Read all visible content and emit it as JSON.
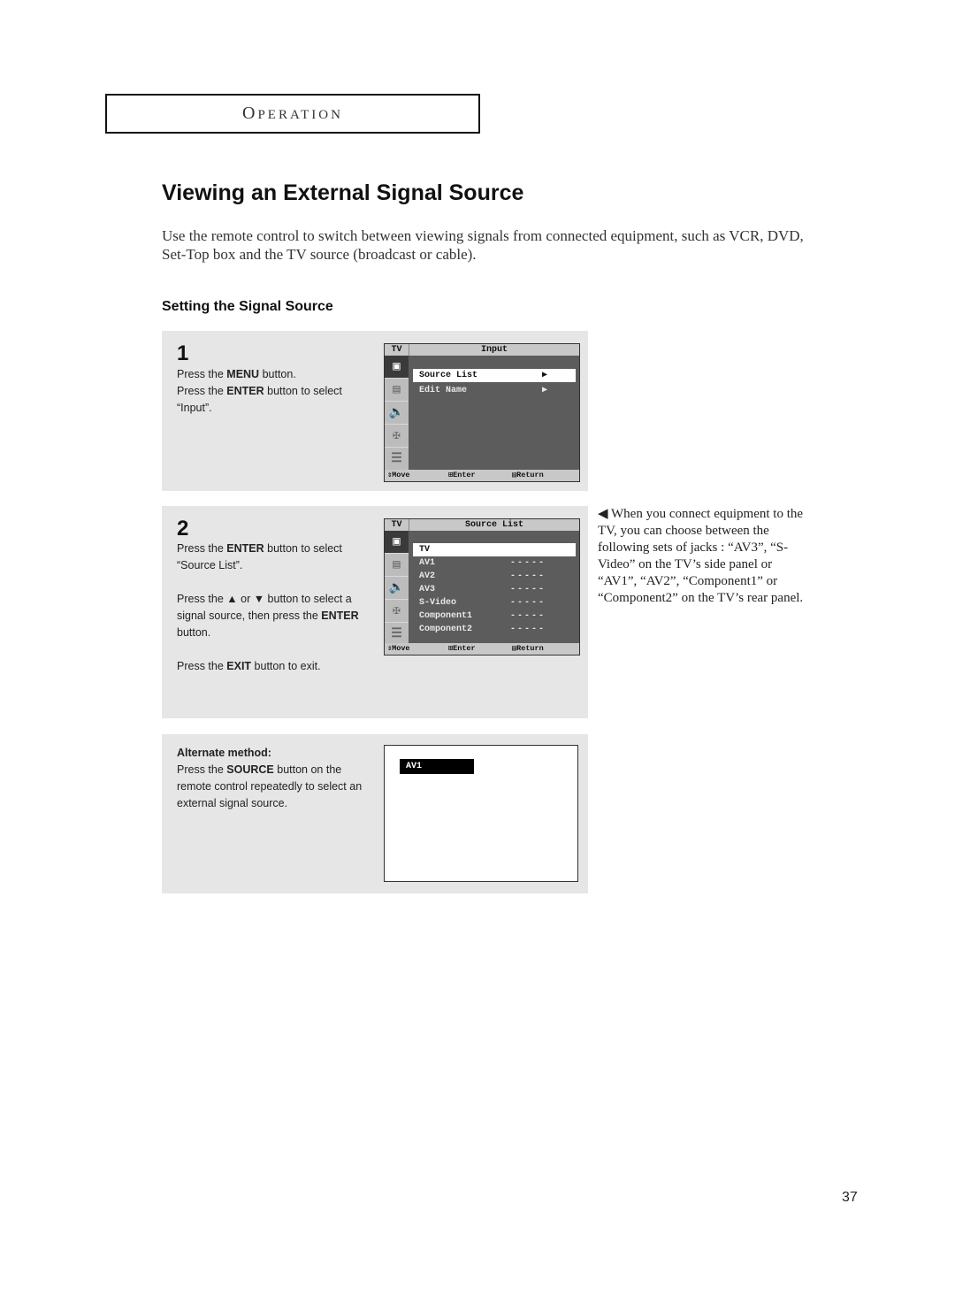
{
  "header": {
    "section_first": "O",
    "section_rest": "PERATION"
  },
  "title": "Viewing an External Signal Source",
  "intro": "Use the remote control to switch between viewing signals from connected equipment, such as VCR, DVD, Set-Top box and the TV source (broadcast or cable).",
  "subtitle": "Setting the Signal Source",
  "step1": {
    "number": "1",
    "lines": [
      {
        "pre": "Press the ",
        "bold": "MENU",
        "post": " button."
      },
      {
        "pre": "Press the ",
        "bold": "ENTER",
        "post": " button to select “Input”."
      }
    ],
    "osd": {
      "tv_label": "TV",
      "title": "Input",
      "items": [
        {
          "label": "Source List",
          "selected": true,
          "arrow": "▶"
        },
        {
          "label": "Edit Name",
          "selected": false,
          "arrow": "▶"
        }
      ],
      "footer": {
        "move": "⇕Move",
        "enter": "Enter",
        "return": "Return"
      }
    }
  },
  "step2": {
    "number": "2",
    "para1": {
      "pre": "Press the ",
      "bold": "ENTER",
      "post": " button to select “Source List”."
    },
    "para2": {
      "pre": "Press the ▲ or ▼ button to select a signal source, then press the ",
      "bold": "ENTER",
      "post": " button."
    },
    "para3": {
      "pre": "Press the ",
      "bold": "EXIT",
      "post": " button to exit."
    },
    "osd": {
      "tv_label": "TV",
      "title": "Source List",
      "items": [
        {
          "label": "TV",
          "selected": true,
          "value": ""
        },
        {
          "label": "AV1",
          "selected": false,
          "value": "-----"
        },
        {
          "label": "AV2",
          "selected": false,
          "value": "-----"
        },
        {
          "label": "AV3",
          "selected": false,
          "value": "-----"
        },
        {
          "label": "S-Video",
          "selected": false,
          "value": "-----"
        },
        {
          "label": "Component1",
          "selected": false,
          "value": "-----"
        },
        {
          "label": "Component2",
          "selected": false,
          "value": "-----"
        }
      ],
      "footer": {
        "move": "⇕Move",
        "enter": "Enter",
        "return": "Return"
      }
    }
  },
  "alternate": {
    "heading": "Alternate method:",
    "text": {
      "pre": "Press the ",
      "bold": "SOURCE",
      "post": " button on the remote control repeatedly to select an external signal source."
    },
    "screen_tag": "AV1"
  },
  "note": "◀ When you connect equipment to the TV, you can choose between the following sets of jacks : “AV3”, “S-Video” on the TV’s side panel or “AV1”, “AV2”, “Component1” or “Component2” on the TV’s rear panel.",
  "page_number": "37"
}
